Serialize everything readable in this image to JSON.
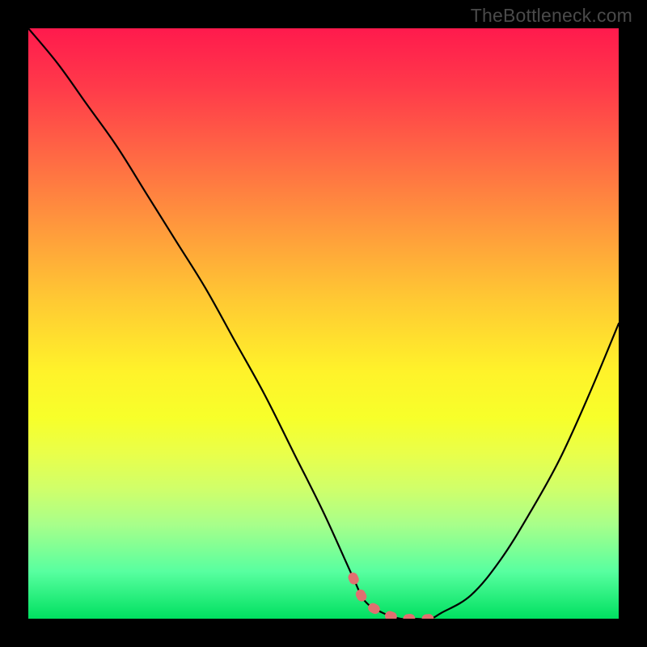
{
  "watermark": "TheBottleneck.com",
  "chart_data": {
    "type": "line",
    "title": "",
    "xlabel": "",
    "ylabel": "",
    "xlim": [
      0,
      100
    ],
    "ylim": [
      0,
      100
    ],
    "grid": false,
    "legend": false,
    "series": [
      {
        "name": "curve",
        "color": "#000000",
        "x": [
          0,
          5,
          10,
          15,
          20,
          25,
          30,
          35,
          40,
          45,
          50,
          55,
          57,
          60,
          63,
          65,
          68,
          70,
          75,
          80,
          85,
          90,
          95,
          100
        ],
        "values": [
          100,
          94,
          87,
          80,
          72,
          64,
          56,
          47,
          38,
          28,
          18,
          7,
          3,
          1,
          0,
          0,
          0,
          1,
          4,
          10,
          18,
          27,
          38,
          50
        ]
      },
      {
        "name": "highlight",
        "color": "#e07070",
        "style": "dashed",
        "x": [
          55,
          57,
          60,
          63,
          65,
          68,
          70
        ],
        "values": [
          7,
          3,
          1,
          0,
          0,
          0,
          1
        ]
      }
    ]
  }
}
